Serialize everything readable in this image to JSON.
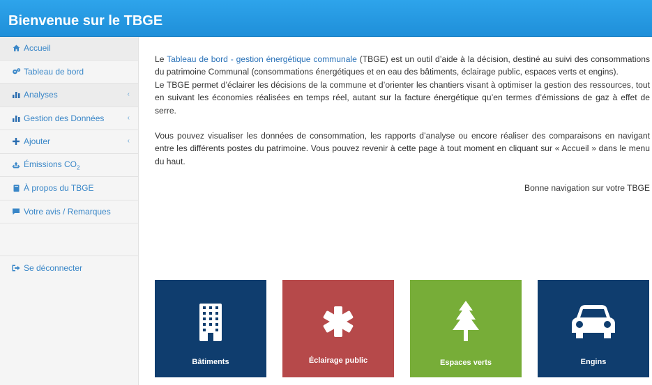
{
  "header": {
    "title": "Bienvenue sur le TBGE"
  },
  "sidebar": {
    "items": [
      {
        "label": "Accueil",
        "icon": "home-icon"
      },
      {
        "label": "Tableau de bord",
        "icon": "gears-icon"
      },
      {
        "label": "Analyses",
        "icon": "bar-chart-icon"
      },
      {
        "label": "Gestion des Données",
        "icon": "bar-chart-icon"
      },
      {
        "label": "Ajouter",
        "icon": "plus-icon"
      },
      {
        "label": "Émissions CO",
        "sub": "2",
        "icon": "recycle-icon"
      },
      {
        "label": "À propos du TBGE",
        "icon": "book-icon"
      },
      {
        "label": "Votre avis / Remarques",
        "icon": "comment-icon"
      }
    ],
    "logout": {
      "label": "Se déconnecter",
      "icon": "sign-out-icon"
    }
  },
  "intro": {
    "p1_before": "Le ",
    "p1_link": "Tableau de bord - gestion énergétique communale",
    "p1_after": " (TBGE) est un outil d’aide à la décision, destiné au suivi des consommations du patrimoine Communal (consommations énergétiques et en eau des bâtiments, éclairage public, espaces verts et engins).",
    "p2": "Le TBGE permet d’éclairer les décisions de la commune et d’orienter les chantiers visant à optimiser la gestion des ressources, tout en suivant les économies réalisées en temps réel, autant sur la facture énergétique qu’en termes d’émissions de gaz à effet de serre.",
    "p3": "Vous pouvez visualiser les données de consommation, les rapports d’analyse ou encore réaliser des comparaisons en navigant entre les différents postes du patrimoine. Vous pouvez revenir à cette page à tout moment en cliquant sur « Accueil » dans le menu du haut.",
    "signoff": "Bonne navigation sur votre TBGE"
  },
  "tiles": [
    {
      "label": "Bâtiments",
      "color": "#0f3d6e",
      "icon": "building-icon"
    },
    {
      "label": "Éclairage public",
      "color": "#b6494a",
      "icon": "asterisk-icon"
    },
    {
      "label": "Espaces verts",
      "color": "#77ad38",
      "icon": "tree-icon"
    },
    {
      "label": "Engins",
      "color": "#0f3d6e",
      "icon": "car-icon"
    }
  ]
}
